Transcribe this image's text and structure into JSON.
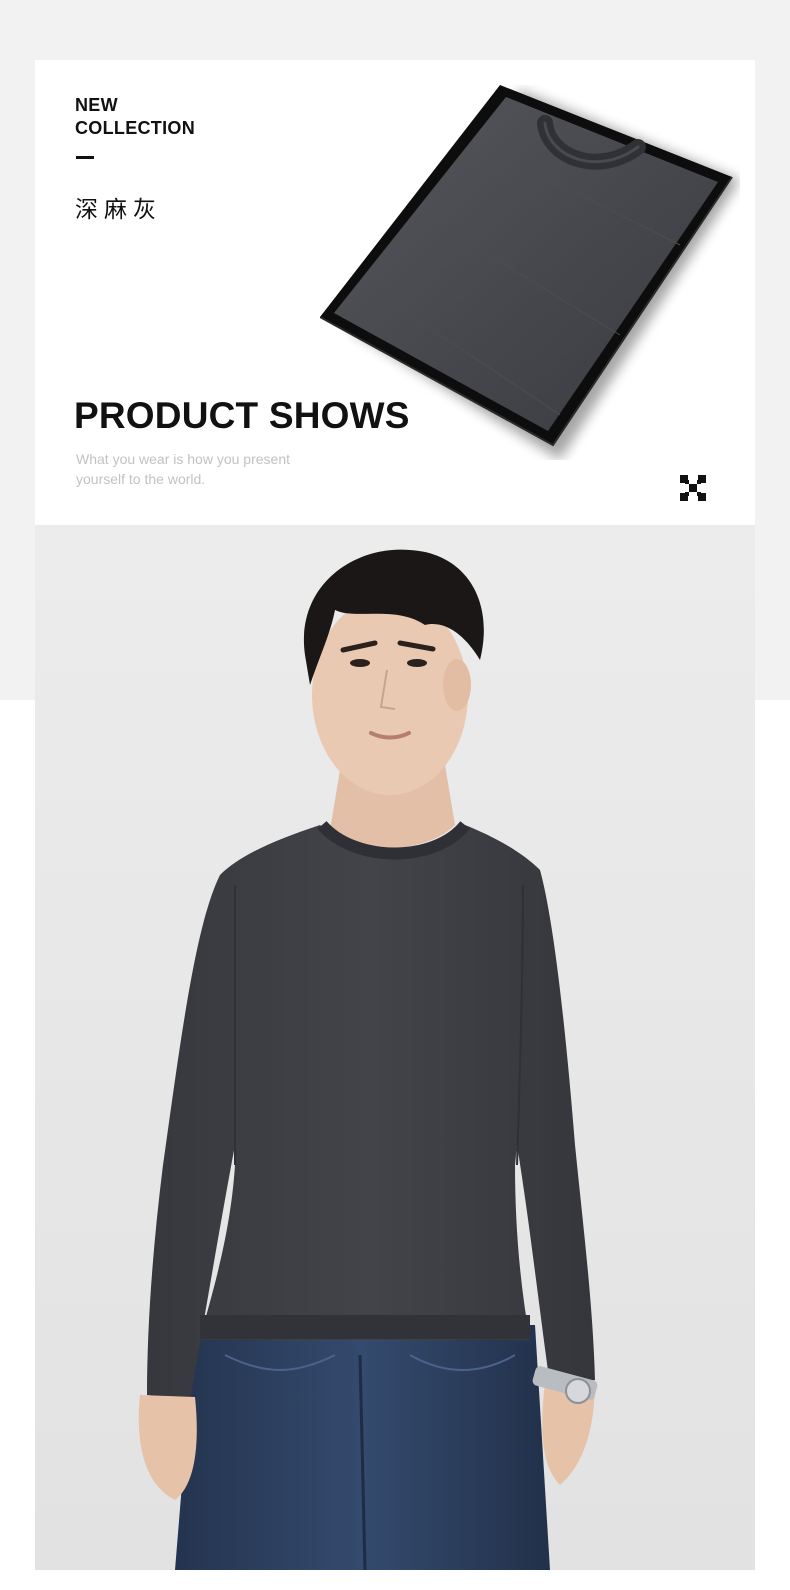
{
  "header": {
    "new_line1": "NEW",
    "new_line2": "COLLECTION",
    "color_name": "深麻灰",
    "headline": "PRODUCT SHOWS",
    "tagline_line1": "What you wear is  how you present",
    "tagline_line2": "yourself to the world."
  },
  "colors": {
    "page_bg": "#f2f2f2",
    "card_bg": "#ffffff",
    "text_primary": "#111111",
    "text_muted": "#c2c2c2",
    "sweater": "#3b3d42",
    "box": "#0d0d0d",
    "jeans": "#2c3f5f",
    "skin": "#e9c9b1",
    "hair": "#1b1716"
  },
  "icons": {
    "brand_logo": "checker-logo-icon"
  }
}
